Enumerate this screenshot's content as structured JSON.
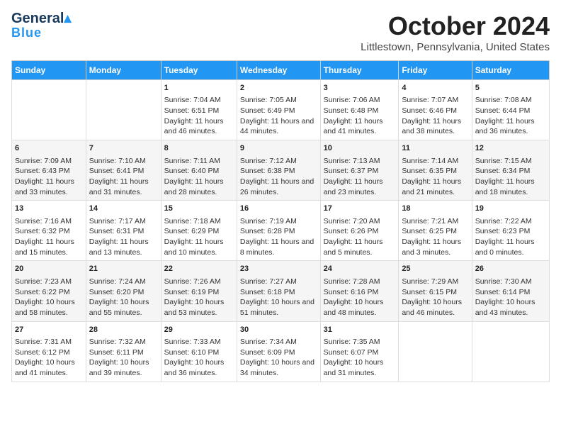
{
  "header": {
    "logo_general": "General",
    "logo_blue": "Blue",
    "month": "October 2024",
    "location": "Littlestown, Pennsylvania, United States"
  },
  "days_of_week": [
    "Sunday",
    "Monday",
    "Tuesday",
    "Wednesday",
    "Thursday",
    "Friday",
    "Saturday"
  ],
  "weeks": [
    [
      {
        "day": "",
        "content": ""
      },
      {
        "day": "",
        "content": ""
      },
      {
        "day": "1",
        "content": "Sunrise: 7:04 AM\nSunset: 6:51 PM\nDaylight: 11 hours and 46 minutes."
      },
      {
        "day": "2",
        "content": "Sunrise: 7:05 AM\nSunset: 6:49 PM\nDaylight: 11 hours and 44 minutes."
      },
      {
        "day": "3",
        "content": "Sunrise: 7:06 AM\nSunset: 6:48 PM\nDaylight: 11 hours and 41 minutes."
      },
      {
        "day": "4",
        "content": "Sunrise: 7:07 AM\nSunset: 6:46 PM\nDaylight: 11 hours and 38 minutes."
      },
      {
        "day": "5",
        "content": "Sunrise: 7:08 AM\nSunset: 6:44 PM\nDaylight: 11 hours and 36 minutes."
      }
    ],
    [
      {
        "day": "6",
        "content": "Sunrise: 7:09 AM\nSunset: 6:43 PM\nDaylight: 11 hours and 33 minutes."
      },
      {
        "day": "7",
        "content": "Sunrise: 7:10 AM\nSunset: 6:41 PM\nDaylight: 11 hours and 31 minutes."
      },
      {
        "day": "8",
        "content": "Sunrise: 7:11 AM\nSunset: 6:40 PM\nDaylight: 11 hours and 28 minutes."
      },
      {
        "day": "9",
        "content": "Sunrise: 7:12 AM\nSunset: 6:38 PM\nDaylight: 11 hours and 26 minutes."
      },
      {
        "day": "10",
        "content": "Sunrise: 7:13 AM\nSunset: 6:37 PM\nDaylight: 11 hours and 23 minutes."
      },
      {
        "day": "11",
        "content": "Sunrise: 7:14 AM\nSunset: 6:35 PM\nDaylight: 11 hours and 21 minutes."
      },
      {
        "day": "12",
        "content": "Sunrise: 7:15 AM\nSunset: 6:34 PM\nDaylight: 11 hours and 18 minutes."
      }
    ],
    [
      {
        "day": "13",
        "content": "Sunrise: 7:16 AM\nSunset: 6:32 PM\nDaylight: 11 hours and 15 minutes."
      },
      {
        "day": "14",
        "content": "Sunrise: 7:17 AM\nSunset: 6:31 PM\nDaylight: 11 hours and 13 minutes."
      },
      {
        "day": "15",
        "content": "Sunrise: 7:18 AM\nSunset: 6:29 PM\nDaylight: 11 hours and 10 minutes."
      },
      {
        "day": "16",
        "content": "Sunrise: 7:19 AM\nSunset: 6:28 PM\nDaylight: 11 hours and 8 minutes."
      },
      {
        "day": "17",
        "content": "Sunrise: 7:20 AM\nSunset: 6:26 PM\nDaylight: 11 hours and 5 minutes."
      },
      {
        "day": "18",
        "content": "Sunrise: 7:21 AM\nSunset: 6:25 PM\nDaylight: 11 hours and 3 minutes."
      },
      {
        "day": "19",
        "content": "Sunrise: 7:22 AM\nSunset: 6:23 PM\nDaylight: 11 hours and 0 minutes."
      }
    ],
    [
      {
        "day": "20",
        "content": "Sunrise: 7:23 AM\nSunset: 6:22 PM\nDaylight: 10 hours and 58 minutes."
      },
      {
        "day": "21",
        "content": "Sunrise: 7:24 AM\nSunset: 6:20 PM\nDaylight: 10 hours and 55 minutes."
      },
      {
        "day": "22",
        "content": "Sunrise: 7:26 AM\nSunset: 6:19 PM\nDaylight: 10 hours and 53 minutes."
      },
      {
        "day": "23",
        "content": "Sunrise: 7:27 AM\nSunset: 6:18 PM\nDaylight: 10 hours and 51 minutes."
      },
      {
        "day": "24",
        "content": "Sunrise: 7:28 AM\nSunset: 6:16 PM\nDaylight: 10 hours and 48 minutes."
      },
      {
        "day": "25",
        "content": "Sunrise: 7:29 AM\nSunset: 6:15 PM\nDaylight: 10 hours and 46 minutes."
      },
      {
        "day": "26",
        "content": "Sunrise: 7:30 AM\nSunset: 6:14 PM\nDaylight: 10 hours and 43 minutes."
      }
    ],
    [
      {
        "day": "27",
        "content": "Sunrise: 7:31 AM\nSunset: 6:12 PM\nDaylight: 10 hours and 41 minutes."
      },
      {
        "day": "28",
        "content": "Sunrise: 7:32 AM\nSunset: 6:11 PM\nDaylight: 10 hours and 39 minutes."
      },
      {
        "day": "29",
        "content": "Sunrise: 7:33 AM\nSunset: 6:10 PM\nDaylight: 10 hours and 36 minutes."
      },
      {
        "day": "30",
        "content": "Sunrise: 7:34 AM\nSunset: 6:09 PM\nDaylight: 10 hours and 34 minutes."
      },
      {
        "day": "31",
        "content": "Sunrise: 7:35 AM\nSunset: 6:07 PM\nDaylight: 10 hours and 31 minutes."
      },
      {
        "day": "",
        "content": ""
      },
      {
        "day": "",
        "content": ""
      }
    ]
  ]
}
